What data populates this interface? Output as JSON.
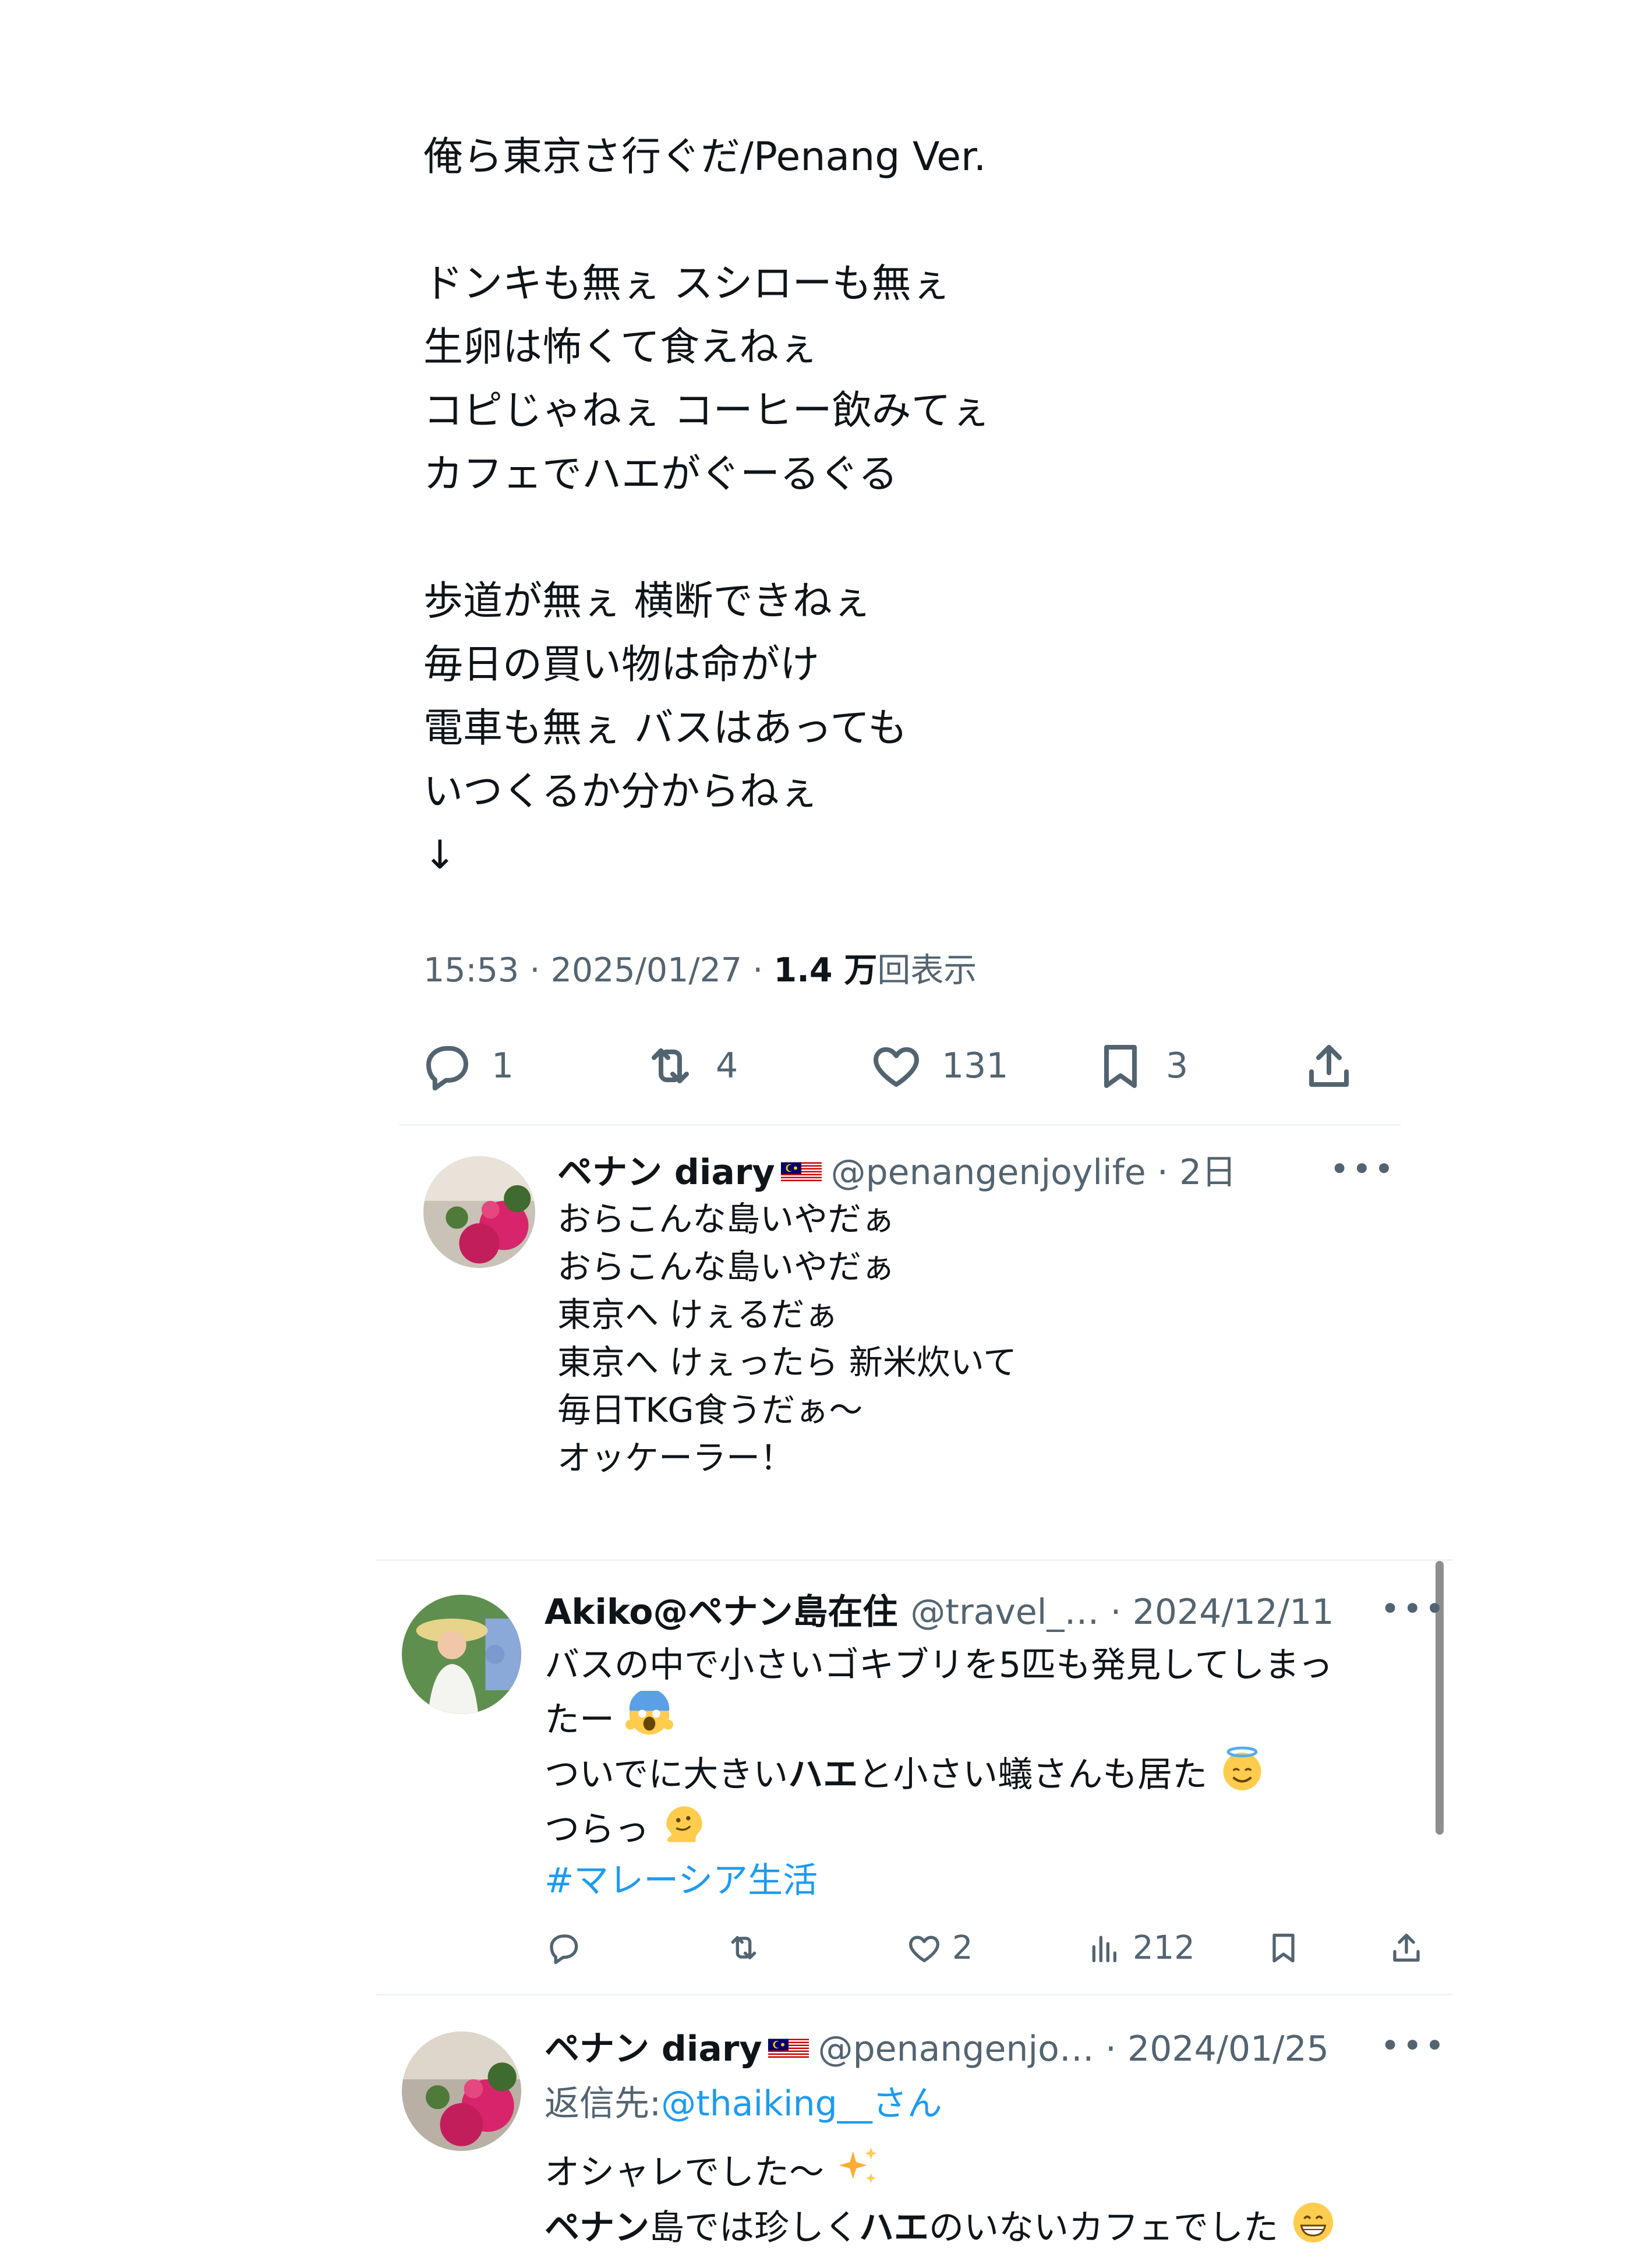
{
  "post": {
    "lines": [
      "俺ら東京さ行ぐだ/Penang  Ver.",
      "",
      "ドンキも無ぇ  スシローも無ぇ",
      "生卵は怖くて食えねぇ",
      "コピじゃねぇ  コーヒー飲みてぇ",
      "カフェでハエがぐーるぐる",
      "",
      "歩道が無ぇ 横断できねぇ",
      "毎日の買い物は命がけ",
      "電車も無ぇ バスはあっても",
      "いつくるか分からねぇ",
      "↓"
    ],
    "time": "15:53",
    "date": "2025/01/27",
    "views_count": "1.4 万",
    "views_label": "回表示",
    "replies": "1",
    "retweets": "4",
    "likes": "131",
    "bookmarks": "3"
  },
  "reply1": {
    "name": "ペナン diary",
    "handle": "@penangenjoylife",
    "age": "2日",
    "lines": [
      "おらこんな島いやだぁ",
      "おらこんな島いやだぁ",
      "東京へ けぇるだぁ",
      "東京へ けぇったら 新米炊いて",
      "毎日TKG食うだぁ〜",
      "オッケーラー！"
    ]
  },
  "reply2": {
    "name": "Akiko@ペナン島在住",
    "handle": "@travel_…",
    "date": "2024/12/11",
    "line1": "バスの中で小さいゴキブリを5匹も発見してしまっ",
    "line2": "たー",
    "line3a": "ついでに大きい",
    "line3b": "ハエ",
    "line3c": "と小さい蟻さんも居た",
    "line4": "つらっ",
    "hashtag": "#マレーシア生活",
    "likes": "2",
    "views": "212"
  },
  "reply3": {
    "name": "ペナン diary",
    "handle": "@penangenjo…",
    "date": "2024/01/25",
    "reply_to_label": "返信先: ",
    "reply_to_user": "@thaiking__さん",
    "line1": "オシャレでした〜",
    "line2a": "ペナン",
    "line2b": "島では珍しく",
    "line2c": "ハエ",
    "line2d": "のいないカフェでした"
  },
  "icons": [
    "reply-icon",
    "retweet-icon",
    "like-icon",
    "bookmark-icon",
    "share-icon",
    "views-icon",
    "more-icon",
    "malaysia-flag-icon"
  ],
  "colors": {
    "text": "#0f1419",
    "secondary": "#536471",
    "link": "#1d9bf0",
    "divider": "#eff3f4"
  }
}
